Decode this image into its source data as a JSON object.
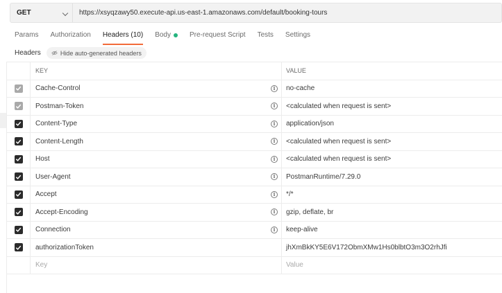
{
  "request": {
    "method": "GET",
    "url": "https://xsyqzawy50.execute-api.us-east-1.amazonaws.com/default/booking-tours"
  },
  "tabs": [
    {
      "label": "Params"
    },
    {
      "label": "Authorization"
    },
    {
      "label": "Headers (10)"
    },
    {
      "label": "Body"
    },
    {
      "label": "Pre-request Script"
    },
    {
      "label": "Tests"
    },
    {
      "label": "Settings"
    }
  ],
  "headers_section": {
    "title": "Headers",
    "hide_button": "Hide auto-generated headers"
  },
  "table": {
    "col_key": "KEY",
    "col_value": "VALUE",
    "rows": [
      {
        "key": "Cache-Control",
        "value": "no-cache"
      },
      {
        "key": "Postman-Token",
        "value": "<calculated when request is sent>"
      },
      {
        "key": "Content-Type",
        "value": "application/json"
      },
      {
        "key": "Content-Length",
        "value": "<calculated when request is sent>"
      },
      {
        "key": "Host",
        "value": "<calculated when request is sent>"
      },
      {
        "key": "User-Agent",
        "value": "PostmanRuntime/7.29.0"
      },
      {
        "key": "Accept",
        "value": "*/*"
      },
      {
        "key": "Accept-Encoding",
        "value": "gzip, deflate, br"
      },
      {
        "key": "Connection",
        "value": "keep-alive"
      },
      {
        "key": "authorizationToken",
        "value": "jhXmBkKY5E6V172ObmXMw1Hs0blbtO3m3O2rhJfi"
      }
    ],
    "placeholder_key": "Key",
    "placeholder_value": "Value"
  },
  "colors": {
    "active_tab_underline": "#f26b3a",
    "body_dot": "#26b47f",
    "checkbox_on": "#2b2b2b",
    "checkbox_auto": "#a9a9a9"
  },
  "icons": [
    "chevron-down-icon",
    "eye-off-icon",
    "checkmark-icon",
    "info-icon"
  ]
}
